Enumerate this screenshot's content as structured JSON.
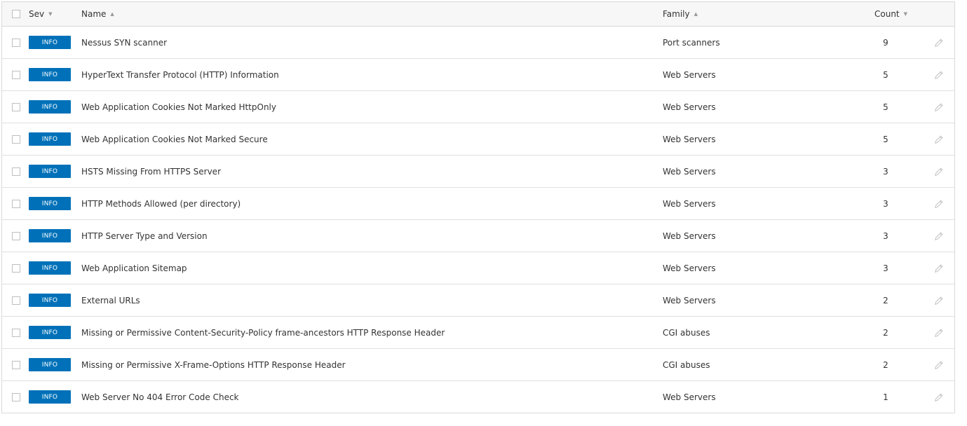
{
  "header": {
    "sev": "Sev",
    "name": "Name",
    "family": "Family",
    "count": "Count",
    "sev_sort": "▼",
    "name_sort": "▲",
    "family_sort": "▲",
    "count_sort": "▼"
  },
  "colors": {
    "info_badge": "#0071b9"
  },
  "rows": [
    {
      "sev": "INFO",
      "name": "Nessus SYN scanner",
      "family": "Port scanners",
      "count": "9"
    },
    {
      "sev": "INFO",
      "name": "HyperText Transfer Protocol (HTTP) Information",
      "family": "Web Servers",
      "count": "5"
    },
    {
      "sev": "INFO",
      "name": "Web Application Cookies Not Marked HttpOnly",
      "family": "Web Servers",
      "count": "5"
    },
    {
      "sev": "INFO",
      "name": "Web Application Cookies Not Marked Secure",
      "family": "Web Servers",
      "count": "5"
    },
    {
      "sev": "INFO",
      "name": "HSTS Missing From HTTPS Server",
      "family": "Web Servers",
      "count": "3"
    },
    {
      "sev": "INFO",
      "name": "HTTP Methods Allowed (per directory)",
      "family": "Web Servers",
      "count": "3"
    },
    {
      "sev": "INFO",
      "name": "HTTP Server Type and Version",
      "family": "Web Servers",
      "count": "3"
    },
    {
      "sev": "INFO",
      "name": "Web Application Sitemap",
      "family": "Web Servers",
      "count": "3"
    },
    {
      "sev": "INFO",
      "name": "External URLs",
      "family": "Web Servers",
      "count": "2"
    },
    {
      "sev": "INFO",
      "name": "Missing or Permissive Content-Security-Policy frame-ancestors HTTP Response Header",
      "family": "CGI abuses",
      "count": "2"
    },
    {
      "sev": "INFO",
      "name": "Missing or Permissive X-Frame-Options HTTP Response Header",
      "family": "CGI abuses",
      "count": "2"
    },
    {
      "sev": "INFO",
      "name": "Web Server No 404 Error Code Check",
      "family": "Web Servers",
      "count": "1"
    }
  ]
}
